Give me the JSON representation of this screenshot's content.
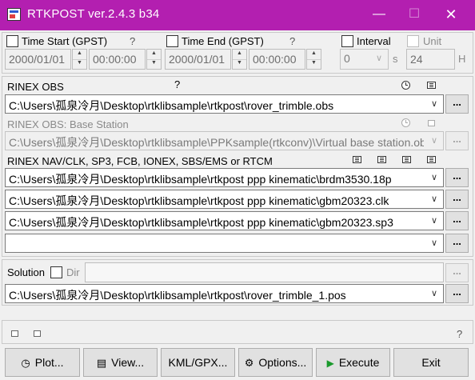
{
  "window": {
    "title": "RTKPOST ver.2.4.3 b34",
    "minimize_glyph": "—",
    "maximize_glyph": "☐",
    "close_glyph": "✕"
  },
  "time": {
    "start_label": "Time Start (GPST)",
    "start_help": "?",
    "start_date": "2000/01/01",
    "start_time": "00:00:00",
    "end_label": "Time End (GPST)",
    "end_help": "?",
    "end_date": "2000/01/01",
    "end_time": "00:00:00",
    "interval_label": "Interval",
    "interval_value": "0",
    "interval_unit": "s",
    "unit_label": "Unit",
    "unit_value": "24",
    "unit_unit": "H"
  },
  "inputs": {
    "rover_label": "RINEX OBS",
    "rover_help": "?",
    "rover_path": "C:\\Users\\孤泉冷月\\Desktop\\rtklibsample\\rtkpost\\rover_trimble.obs",
    "base_label": "RINEX OBS: Base Station",
    "base_path": "C:\\Users\\孤泉冷月\\Desktop\\rtklibsample\\PPKsample(rtkconv)\\Virtual base station.obs",
    "nav_label": "RINEX NAV/CLK, SP3, FCB, IONEX, SBS/EMS  or RTCM",
    "nav_path_1": "C:\\Users\\孤泉冷月\\Desktop\\rtklibsample\\rtkpost ppp kinematic\\brdm3530.18p",
    "nav_path_2": "C:\\Users\\孤泉冷月\\Desktop\\rtklibsample\\rtkpost ppp kinematic\\gbm20323.clk",
    "nav_path_3": "C:\\Users\\孤泉冷月\\Desktop\\rtklibsample\\rtkpost ppp kinematic\\gbm20323.sp3",
    "nav_path_4": "",
    "browse_label": "..."
  },
  "output": {
    "solution_label": "Solution",
    "dir_label": "Dir",
    "dir_value": "",
    "solution_path": "C:\\Users\\孤泉冷月\\Desktop\\rtklibsample\\rtkpost\\rover_trimble_1.pos"
  },
  "status": {
    "help": "?"
  },
  "buttons": {
    "plot": "Plot...",
    "view": "View...",
    "kml": "KML/GPX...",
    "options": "Options...",
    "execute": "Execute",
    "exit": "Exit"
  }
}
